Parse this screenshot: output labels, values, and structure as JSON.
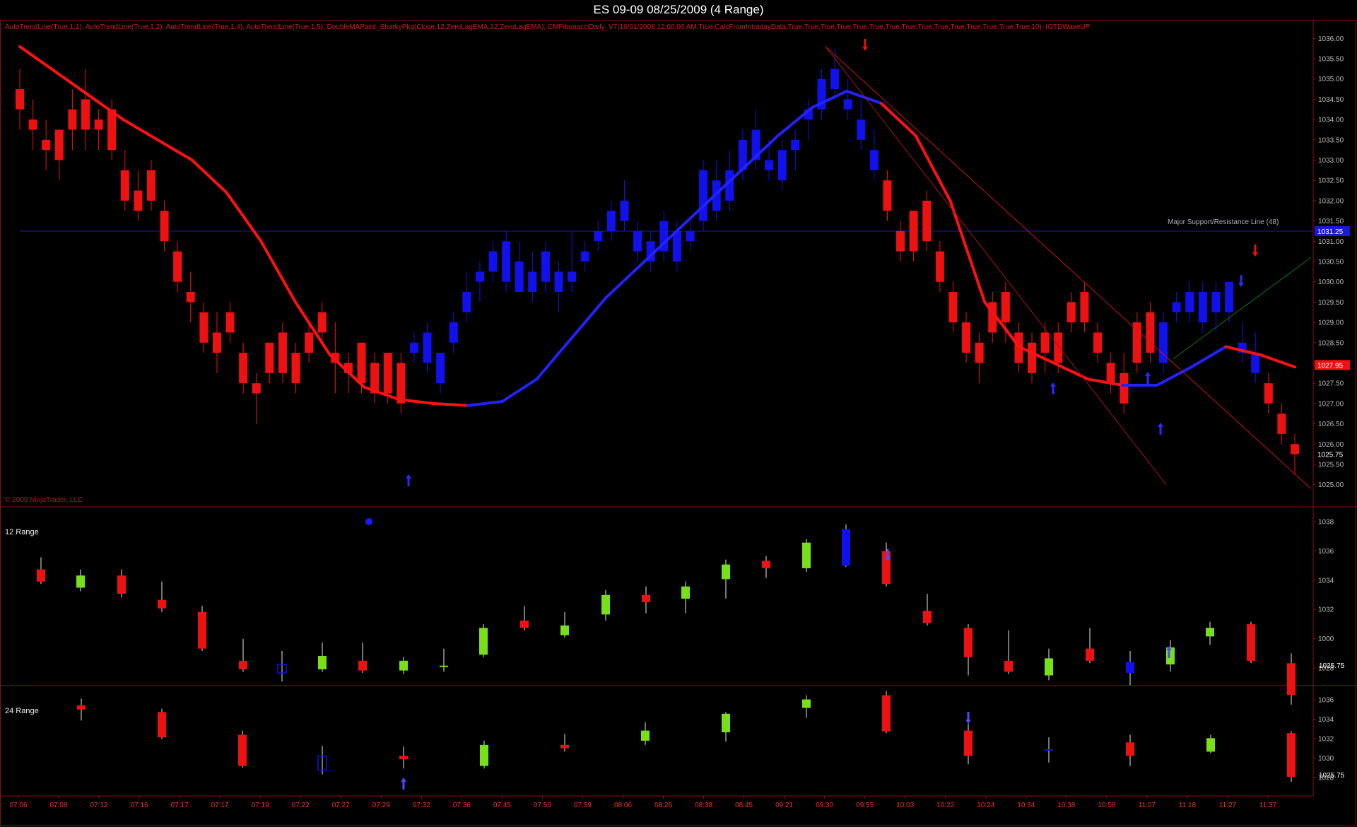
{
  "window": {
    "title": "ES 09-09  08/25/2009 (4 Range)"
  },
  "main_panel": {
    "indicator_text": "AutoTrendLine(True,1,1), AutoTrendLine(True,1,2), AutoTrendLine(True,1,4), AutoTrendLine(True,1,5), DoubleMAPaint_SharkyPkg(Close,12,ZeroLagEMA,12,ZeroLagEMA), CMFibonacciDaily_V7(10/01/2008 12:00:00 AM,True,CalcFromIntradayData,True,True,True,True,True,True,True,True,True,True,True,True,True,True,True,10), IGTDWaveUP",
    "copyright": "© 2009 NinjaTrader, LLC",
    "support_label": "Major Support/Resistance Line (48)",
    "support_price": "1031.25",
    "ma_price": "1027.95",
    "last_price": "1025.75",
    "y_ticks": [
      "1036.00",
      "1035.50",
      "1035.00",
      "1034.50",
      "1034.00",
      "1033.50",
      "1033.00",
      "1032.50",
      "1032.00",
      "1031.50",
      "1031.00",
      "1030.50",
      "1030.00",
      "1029.50",
      "1029.00",
      "1028.50",
      "1028.00",
      "1027.50",
      "1027.00",
      "1026.50",
      "1026.00",
      "1025.50",
      "1025.00"
    ]
  },
  "panel_12": {
    "label": "12 Range",
    "last_price": "1025.75",
    "y_ticks": [
      "1038",
      "1036",
      "1034",
      "1032",
      "1000",
      "1028"
    ]
  },
  "panel_24": {
    "label": "24 Range",
    "last_price": "1025.75",
    "y_ticks": [
      "1036",
      "1034",
      "1032",
      "1030",
      "1028"
    ]
  },
  "x_axis": {
    "labels": [
      "07:06",
      "07:08",
      "07:12",
      "07:16",
      "07:17",
      "07:17",
      "07:19",
      "07:22",
      "07:27",
      "07:29",
      "07:32",
      "07:36",
      "07:45",
      "07:50",
      "07:59",
      "08:06",
      "08:26",
      "08:38",
      "08:45",
      "09:21",
      "09:30",
      "09:55",
      "10:03",
      "10:22",
      "10:24",
      "10:34",
      "10:38",
      "10:58",
      "11:07",
      "11:18",
      "11:27",
      "11:37"
    ]
  },
  "colors": {
    "bear": "#ee1111",
    "bull": "#1111ee",
    "green_bar": "#77e01a",
    "axis": "#8c1010",
    "ma_red": "#ff1111",
    "ma_blue": "#2222ff"
  },
  "chart_data": [
    {
      "type": "candlestick",
      "title": "ES 09-09  08/25/2009 (4 Range)",
      "ylim": [
        1024.75,
        1036.25
      ],
      "bars": [
        [
          "r",
          1034.75,
          1034.25,
          1035.25,
          1033.75
        ],
        [
          "r",
          1034.0,
          1033.75,
          1034.5,
          1033.25
        ],
        [
          "r",
          1033.5,
          1033.25,
          1034.0,
          1032.75
        ],
        [
          "r",
          1033.75,
          1033.0,
          1033.75,
          1032.5
        ],
        [
          "r",
          1034.25,
          1033.75,
          1034.75,
          1033.25
        ],
        [
          "r",
          1034.5,
          1033.75,
          1035.25,
          1033.25
        ],
        [
          "r",
          1034.0,
          1033.75,
          1034.25,
          1033.25
        ],
        [
          "r",
          1034.25,
          1033.25,
          1034.5,
          1033.0
        ],
        [
          "r",
          1032.75,
          1032.0,
          1033.25,
          1031.75
        ],
        [
          "r",
          1032.25,
          1031.75,
          1032.75,
          1031.5
        ],
        [
          "r",
          1032.75,
          1032.0,
          1033.0,
          1031.75
        ],
        [
          "r",
          1031.75,
          1031.0,
          1032.0,
          1030.75
        ],
        [
          "r",
          1030.75,
          1030.0,
          1031.0,
          1029.75
        ],
        [
          "r",
          1029.75,
          1029.5,
          1030.25,
          1029.0
        ],
        [
          "r",
          1029.25,
          1028.5,
          1029.5,
          1028.25
        ],
        [
          "r",
          1028.75,
          1028.25,
          1029.25,
          1027.75
        ],
        [
          "r",
          1029.25,
          1028.75,
          1029.5,
          1028.5
        ],
        [
          "r",
          1028.25,
          1027.5,
          1028.5,
          1027.25
        ],
        [
          "r",
          1027.5,
          1027.25,
          1027.75,
          1026.5
        ],
        [
          "r",
          1028.5,
          1027.75,
          1028.5,
          1027.5
        ],
        [
          "r",
          1028.75,
          1027.75,
          1029.0,
          1027.5
        ],
        [
          "r",
          1028.25,
          1027.5,
          1028.5,
          1027.25
        ],
        [
          "r",
          1028.75,
          1028.25,
          1029.0,
          1028.0
        ],
        [
          "r",
          1029.25,
          1028.75,
          1029.5,
          1028.5
        ],
        [
          "r",
          1028.25,
          1028.0,
          1029.0,
          1027.25
        ],
        [
          "r",
          1028.0,
          1027.75,
          1028.25,
          1027.25
        ],
        [
          "r",
          1028.5,
          1027.5,
          1028.5,
          1027.25
        ],
        [
          "r",
          1028.0,
          1027.25,
          1028.25,
          1027.0
        ],
        [
          "r",
          1028.25,
          1027.25,
          1028.25,
          1027.0
        ],
        [
          "r",
          1028.0,
          1027.0,
          1028.25,
          1026.75
        ],
        [
          "b",
          1028.25,
          1028.5,
          1028.75,
          1028.0
        ],
        [
          "b",
          1028.0,
          1028.75,
          1029.0,
          1027.75
        ],
        [
          "b",
          1027.5,
          1028.25,
          1028.25,
          1027.25
        ],
        [
          "b",
          1028.5,
          1029.0,
          1029.25,
          1028.25
        ],
        [
          "b",
          1029.25,
          1029.75,
          1030.25,
          1029.0
        ],
        [
          "b",
          1030.0,
          1030.25,
          1030.5,
          1029.5
        ],
        [
          "b",
          1030.25,
          1030.75,
          1031.0,
          1030.0
        ],
        [
          "b",
          1030.0,
          1031.0,
          1031.25,
          1029.75
        ],
        [
          "b",
          1029.75,
          1030.5,
          1031.0,
          1029.75
        ],
        [
          "b",
          1029.75,
          1030.25,
          1030.75,
          1029.5
        ],
        [
          "b",
          1030.0,
          1030.75,
          1031.0,
          1029.75
        ],
        [
          "b",
          1029.75,
          1030.25,
          1030.5,
          1029.25
        ],
        [
          "b",
          1030.0,
          1030.25,
          1031.25,
          1029.75
        ],
        [
          "b",
          1030.5,
          1030.75,
          1031.0,
          1030.25
        ],
        [
          "b",
          1031.0,
          1031.25,
          1031.5,
          1030.75
        ],
        [
          "b",
          1031.25,
          1031.75,
          1032.0,
          1031.0
        ],
        [
          "b",
          1031.5,
          1032.0,
          1032.5,
          1031.25
        ],
        [
          "b",
          1030.75,
          1031.25,
          1031.5,
          1030.5
        ],
        [
          "b",
          1030.5,
          1031.0,
          1031.25,
          1030.25
        ],
        [
          "b",
          1030.75,
          1031.5,
          1031.75,
          1030.5
        ],
        [
          "b",
          1030.5,
          1031.25,
          1031.5,
          1030.25
        ],
        [
          "b",
          1031.0,
          1031.25,
          1031.5,
          1030.75
        ],
        [
          "b",
          1031.5,
          1032.75,
          1033.0,
          1031.25
        ],
        [
          "b",
          1031.75,
          1032.5,
          1033.0,
          1031.5
        ],
        [
          "b",
          1032.0,
          1032.75,
          1033.25,
          1031.75
        ],
        [
          "b",
          1032.75,
          1033.5,
          1033.75,
          1032.5
        ],
        [
          "b",
          1033.0,
          1033.75,
          1034.25,
          1032.75
        ],
        [
          "b",
          1032.75,
          1033.0,
          1033.5,
          1032.5
        ],
        [
          "b",
          1032.5,
          1033.25,
          1033.5,
          1032.25
        ],
        [
          "b",
          1033.25,
          1033.5,
          1033.75,
          1032.75
        ],
        [
          "b",
          1034.0,
          1034.25,
          1034.5,
          1033.5
        ],
        [
          "b",
          1034.25,
          1035.0,
          1035.25,
          1034.0
        ],
        [
          "b",
          1034.75,
          1035.25,
          1035.75,
          1034.5
        ],
        [
          "b",
          1034.25,
          1034.5,
          1035.0,
          1034.0
        ],
        [
          "b",
          1033.5,
          1034.0,
          1034.5,
          1033.25
        ],
        [
          "b",
          1032.75,
          1033.25,
          1033.75,
          1032.5
        ],
        [
          "r",
          1032.5,
          1031.75,
          1032.75,
          1031.5
        ],
        [
          "r",
          1031.25,
          1030.75,
          1031.5,
          1030.5
        ],
        [
          "r",
          1031.75,
          1030.75,
          1031.75,
          1030.5
        ],
        [
          "r",
          1032.0,
          1031.0,
          1032.25,
          1030.75
        ],
        [
          "r",
          1030.75,
          1030.0,
          1031.0,
          1029.75
        ],
        [
          "r",
          1029.75,
          1029.0,
          1030.0,
          1028.75
        ],
        [
          "r",
          1029.0,
          1028.25,
          1029.25,
          1028.0
        ],
        [
          "r",
          1028.5,
          1028.0,
          1028.75,
          1027.5
        ],
        [
          "r",
          1029.5,
          1028.75,
          1029.75,
          1028.5
        ],
        [
          "r",
          1029.75,
          1029.0,
          1030.0,
          1028.5
        ],
        [
          "r",
          1028.75,
          1028.0,
          1029.0,
          1027.75
        ],
        [
          "r",
          1028.5,
          1027.75,
          1028.75,
          1027.5
        ],
        [
          "r",
          1028.75,
          1028.25,
          1029.0,
          1027.75
        ],
        [
          "r",
          1028.75,
          1028.0,
          1029.0,
          1027.75
        ],
        [
          "r",
          1029.5,
          1029.0,
          1029.75,
          1028.75
        ],
        [
          "r",
          1029.75,
          1029.0,
          1030.0,
          1028.75
        ],
        [
          "r",
          1028.75,
          1028.25,
          1029.0,
          1028.0
        ],
        [
          "r",
          1028.0,
          1027.5,
          1028.25,
          1027.25
        ],
        [
          "r",
          1027.75,
          1027.0,
          1028.25,
          1026.75
        ],
        [
          "r",
          1029.0,
          1028.0,
          1029.25,
          1027.75
        ],
        [
          "r",
          1029.25,
          1028.25,
          1029.5,
          1028.0
        ],
        [
          "b",
          1028.0,
          1029.0,
          1029.25,
          1027.75
        ],
        [
          "b",
          1029.25,
          1029.5,
          1029.75,
          1029.0
        ],
        [
          "b",
          1029.25,
          1029.75,
          1030.0,
          1029.0
        ],
        [
          "b",
          1029.0,
          1029.75,
          1030.0,
          1028.75
        ],
        [
          "b",
          1029.25,
          1029.75,
          1030.0,
          1028.75
        ],
        [
          "b",
          1029.25,
          1030.0,
          1030.0,
          1029.0
        ],
        [
          "b",
          1028.25,
          1028.5,
          1029.0,
          1028.0
        ],
        [
          "b",
          1027.75,
          1028.25,
          1028.75,
          1027.5
        ],
        [
          "r",
          1027.5,
          1027.0,
          1027.75,
          1026.75
        ],
        [
          "r",
          1026.75,
          1026.25,
          1027.0,
          1026.0
        ],
        [
          "r",
          1026.0,
          1025.75,
          1026.25,
          1025.25
        ]
      ],
      "horizontal_line": 1031.25,
      "moving_average": [
        1035.8,
        1035.2,
        1034.6,
        1034.0,
        1033.5,
        1033.0,
        1032.2,
        1031.0,
        1029.5,
        1028.2,
        1027.4,
        1027.1,
        1027.0,
        1026.95,
        1027.05,
        1027.6,
        1028.6,
        1029.6,
        1030.4,
        1031.2,
        1032.0,
        1032.8,
        1033.6,
        1034.3,
        1034.7,
        1034.4,
        1033.6,
        1032.0,
        1029.5,
        1028.4,
        1028.0,
        1027.6,
        1027.45,
        1027.45,
        1027.9,
        1028.4,
        1028.2,
        1027.9
      ]
    },
    {
      "type": "candlestick",
      "title": "12 Range",
      "ylim": [
        1024.75,
        1038.5
      ]
    },
    {
      "type": "candlestick",
      "title": "24 Range",
      "ylim": [
        1024.75,
        1036.5
      ]
    }
  ]
}
